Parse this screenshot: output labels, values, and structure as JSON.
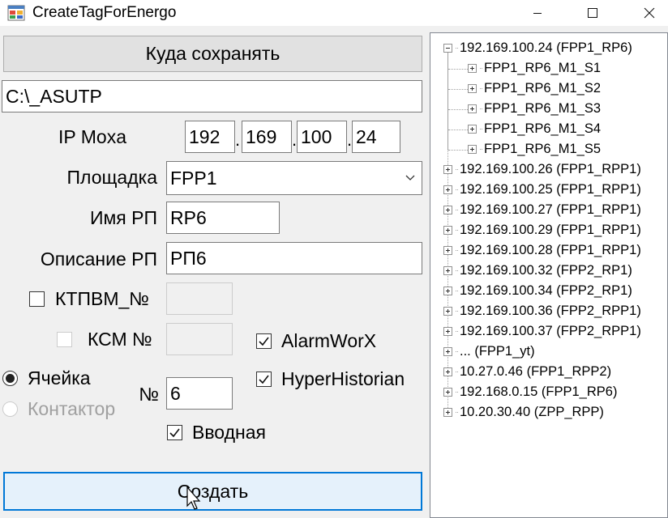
{
  "window": {
    "title": "CreateTagForEnergo",
    "minimize_icon": "minimize-icon",
    "maximize_icon": "maximize-icon",
    "close_icon": "close-icon"
  },
  "form": {
    "save_location_button": "Куда сохранять",
    "save_path_value": "C:\\_ASUTP",
    "ip_label": "IP Moxa",
    "ip_octets": [
      "192",
      "169",
      "100",
      "24"
    ],
    "ip_separator": ".",
    "site_label": "Площадка",
    "site_selected": "FPP1",
    "rp_name_label": "Имя РП",
    "rp_name_value": "RP6",
    "rp_desc_label": "Описание РП",
    "rp_desc_value": "РП6",
    "ktpvm_label": "КТПВМ_№",
    "ktpvm_checked": false,
    "ksm_label": "КСМ №",
    "ksm_checked": false,
    "alarmworx_label": "AlarmWorX",
    "alarmworx_checked": true,
    "hyperhistorian_label": "HyperHistorian",
    "hyperhistorian_checked": true,
    "cell_radio_label": "Ячейка",
    "cell_selected": true,
    "contactor_radio_label": "Контактор",
    "number_label": "№",
    "number_value": "6",
    "input_label": "Вводная",
    "input_checked": true,
    "create_button": "Создать"
  },
  "tree": {
    "nodes": [
      {
        "label": "192.169.100.24 (FPP1_RP6)",
        "expanded": true,
        "children": [
          {
            "label": "FPP1_RP6_M1_S1"
          },
          {
            "label": "FPP1_RP6_M1_S2"
          },
          {
            "label": "FPP1_RP6_M1_S3"
          },
          {
            "label": "FPP1_RP6_M1_S4"
          },
          {
            "label": "FPP1_RP6_M1_S5"
          }
        ]
      },
      {
        "label": "192.169.100.26 (FPP1_RPP1)"
      },
      {
        "label": "192.169.100.25 (FPP1_RPP1)"
      },
      {
        "label": "192.169.100.27 (FPP1_RPP1)"
      },
      {
        "label": "192.169.100.29 (FPP1_RPP1)"
      },
      {
        "label": "192.169.100.28 (FPP1_RPP1)"
      },
      {
        "label": "192.169.100.32 (FPP2_RP1)"
      },
      {
        "label": "192.169.100.34 (FPP2_RP1)"
      },
      {
        "label": "192.169.100.36 (FPP2_RPP1)"
      },
      {
        "label": "192.169.100.37 (FPP2_RPP1)"
      },
      {
        "label": "... (FPP1_yt)"
      },
      {
        "label": "10.27.0.46 (FPP1_RPP2)"
      },
      {
        "label": "192.168.0.15 (FPP1_RP6)"
      },
      {
        "label": "10.20.30.40 (ZPP_RPP)"
      }
    ]
  }
}
